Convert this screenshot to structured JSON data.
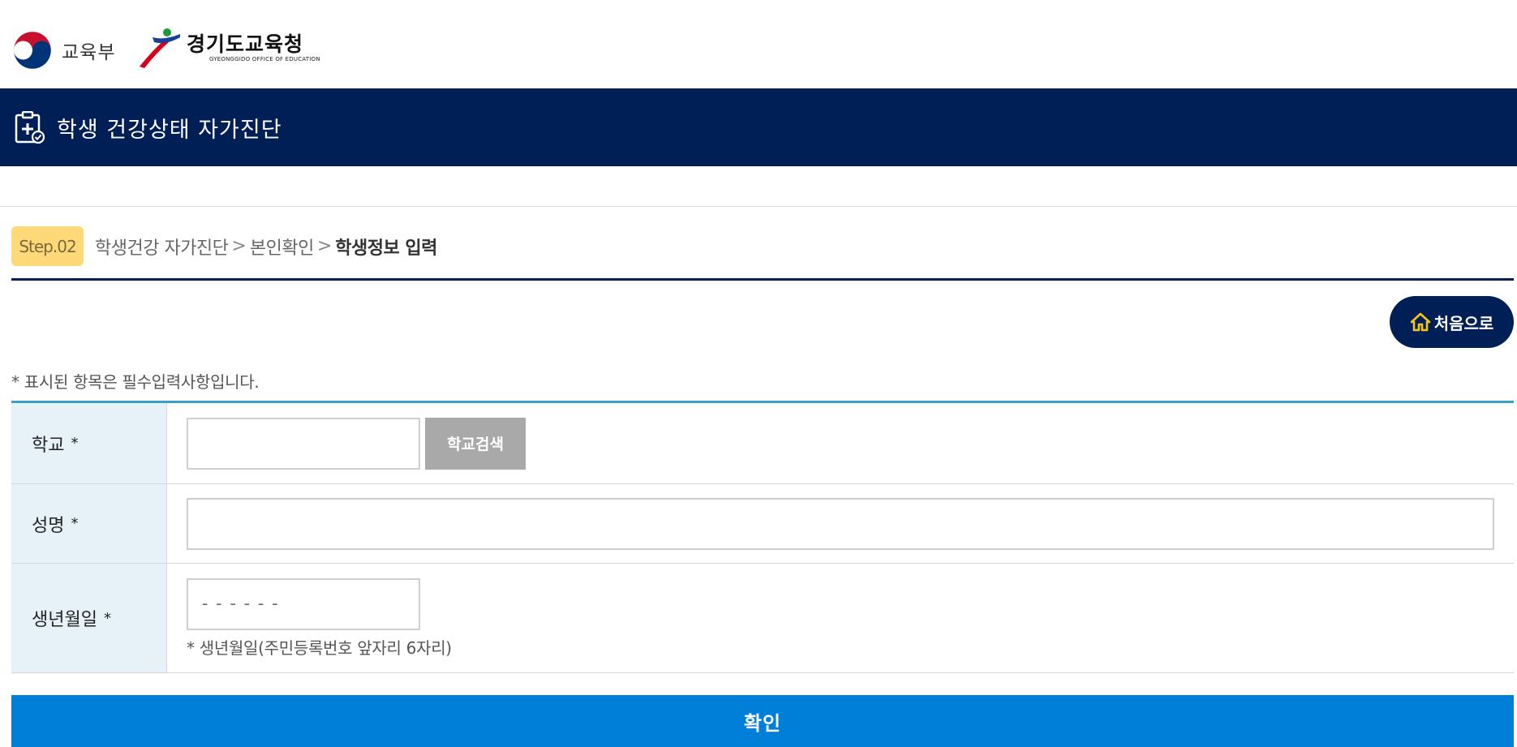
{
  "header": {
    "ministry_name": "교육부",
    "office_name": "경기도교육청",
    "office_english": "GYEONGGIDO OFFICE OF EDUCATION"
  },
  "title_bar": {
    "icon": "clipboard-medical-icon",
    "title": "학생 건강상태 자가진단"
  },
  "breadcrumb": {
    "step": "Step.02",
    "items": [
      "학생건강 자가진단",
      "본인확인"
    ],
    "current": "학생정보 입력",
    "separator": ">"
  },
  "home_button": {
    "icon": "home-icon",
    "label": "처음으로"
  },
  "form": {
    "required_note": "* 표시된 항목은 필수입력사항입니다.",
    "required_mark": "*",
    "school": {
      "label": "학교",
      "value": "",
      "search_button": "학교검색"
    },
    "name": {
      "label": "성명",
      "value": ""
    },
    "birth": {
      "label": "생년월일",
      "placeholder": "------",
      "hint": "* 생년월일(주민등록번호 앞자리 6자리)"
    }
  },
  "confirm_button": "확인",
  "colors": {
    "navy": "#001f57",
    "step_badge": "#ffd978",
    "table_top_border": "#3aa0c8",
    "label_bg": "#e6f2f7",
    "search_button_bg": "#a9a9a9",
    "confirm_bg": "#007fd9",
    "home_icon": "#f5c518"
  }
}
